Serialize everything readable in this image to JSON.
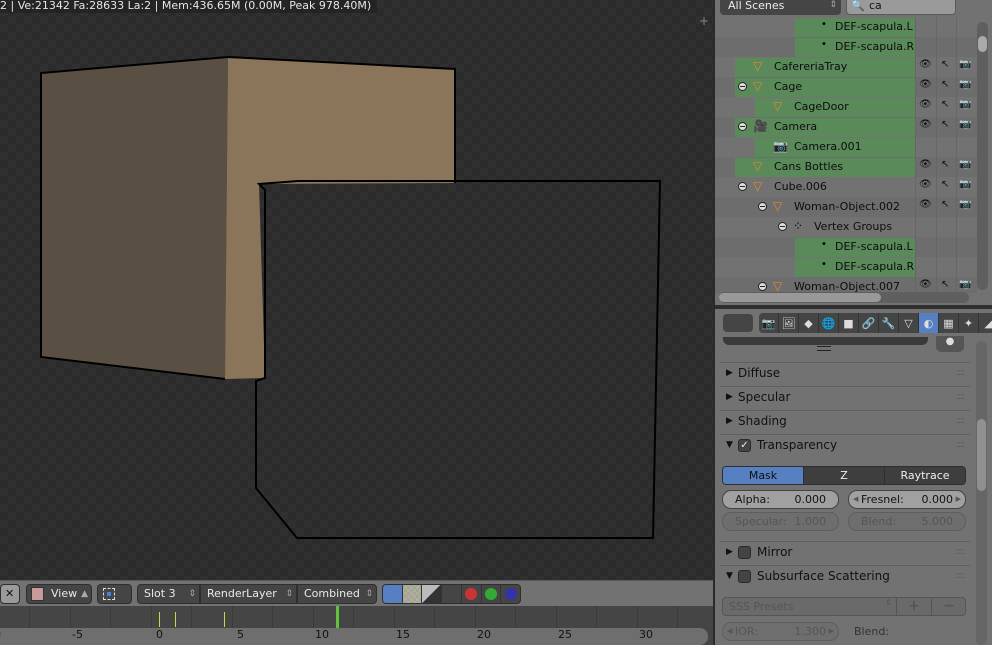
{
  "viewport": {
    "info": "2 | Ve:21342 Fa:28633 La:2 | Mem:436.65M (0.00M, Peak 978.40M)"
  },
  "image_header": {
    "close_icon": "✕",
    "view_label": "View",
    "slot_label": "Slot 3",
    "render_layer_label": "RenderLayer",
    "pass_label": "Combined",
    "display_channels": [
      "color-alpha",
      "alpha-checker",
      "alpha",
      "z-buffer",
      "red",
      "green",
      "blue"
    ],
    "active_channel": "color-alpha"
  },
  "timeline": {
    "tick_labels": [
      "0",
      "-5",
      "0",
      "5",
      "10",
      "15",
      "20",
      "25",
      "30"
    ],
    "current_frame": 11,
    "keyframes": [
      0,
      1,
      4
    ]
  },
  "outliner": {
    "scene_filter": "All Scenes",
    "search_value": "ca",
    "rows": [
      {
        "label": "DEF-scapula.L",
        "type": "vertex-group-item",
        "highlight": true,
        "visible": false
      },
      {
        "label": "DEF-scapula.R",
        "type": "vertex-group-item",
        "highlight": true,
        "visible": false
      },
      {
        "label": "CafereriaTray",
        "type": "mesh",
        "highlight": true,
        "visible": true
      },
      {
        "label": "Cage",
        "type": "mesh",
        "highlight": true,
        "visible": true,
        "expanded": true
      },
      {
        "label": "CageDoor",
        "type": "mesh",
        "highlight": true,
        "visible": true
      },
      {
        "label": "Camera",
        "type": "camera",
        "highlight": true,
        "visible": true,
        "expanded": true
      },
      {
        "label": "Camera.001",
        "type": "camera-data",
        "highlight": true,
        "visible": false
      },
      {
        "label": "Cans Bottles",
        "type": "mesh",
        "highlight": true,
        "visible": true
      },
      {
        "label": "Cube.006",
        "type": "mesh",
        "highlight": false,
        "visible": true,
        "expanded": true
      },
      {
        "label": "Woman-Object.002",
        "type": "mesh",
        "highlight": false,
        "visible": true,
        "expanded": true
      },
      {
        "label": "Vertex Groups",
        "type": "vertex-groups",
        "highlight": false,
        "visible": false,
        "expanded": true
      },
      {
        "label": "DEF-scapula.L",
        "type": "vertex-group-item",
        "highlight": true,
        "visible": false
      },
      {
        "label": "DEF-scapula.R",
        "type": "vertex-group-item",
        "highlight": true,
        "visible": false
      },
      {
        "label": "Woman-Object.007",
        "type": "mesh",
        "highlight": false,
        "visible": true,
        "expanded": true
      }
    ]
  },
  "properties": {
    "context_tabs": [
      "render",
      "render-layers",
      "scene",
      "world",
      "object",
      "constraints",
      "modifiers",
      "data",
      "material",
      "texture",
      "particles",
      "physics"
    ],
    "active_tab": "material",
    "panels": {
      "diffuse": "Diffuse",
      "specular": "Specular",
      "shading": "Shading",
      "transparency": "Transparency",
      "mirror": "Mirror",
      "sss": "Subsurface Scattering"
    },
    "transparency_enabled": true,
    "mirror_enabled": false,
    "sss_enabled": false,
    "transparency_modes": [
      "Mask",
      "Z Transparency",
      "Raytrace"
    ],
    "transparency_active_mode": "Mask",
    "alpha": {
      "label": "Alpha:",
      "value": "0.000"
    },
    "fresnel": {
      "label": "Fresnel:",
      "value": "0.000"
    },
    "specular": {
      "label": "Specular:",
      "value": "1.000"
    },
    "blend": {
      "label": "Blend:",
      "value": "5.000"
    },
    "sss_presets": "SSS Presets",
    "ior": {
      "label": "IOR:",
      "value": "1.300"
    },
    "sss_blend_label": "Blend:"
  }
}
